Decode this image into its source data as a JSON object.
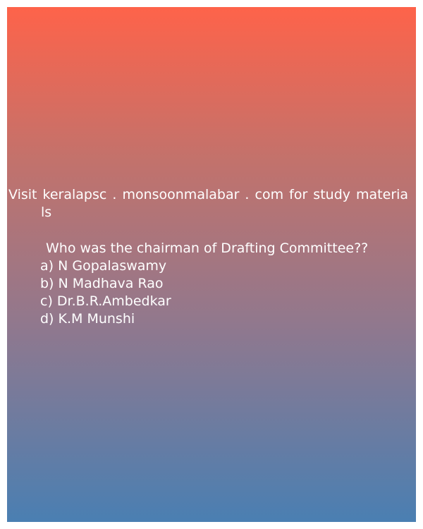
{
  "promo": {
    "line1": "Visit keralapsc . monsoonmalabar . com for study materia",
    "line2": "ls"
  },
  "question": "Who was the chairman of Drafting Committee??",
  "options": [
    "a) N Gopalaswamy",
    "b) N Madhava Rao",
    "c) Dr.B.R.Ambedkar",
    "d) K.M Munshi"
  ]
}
